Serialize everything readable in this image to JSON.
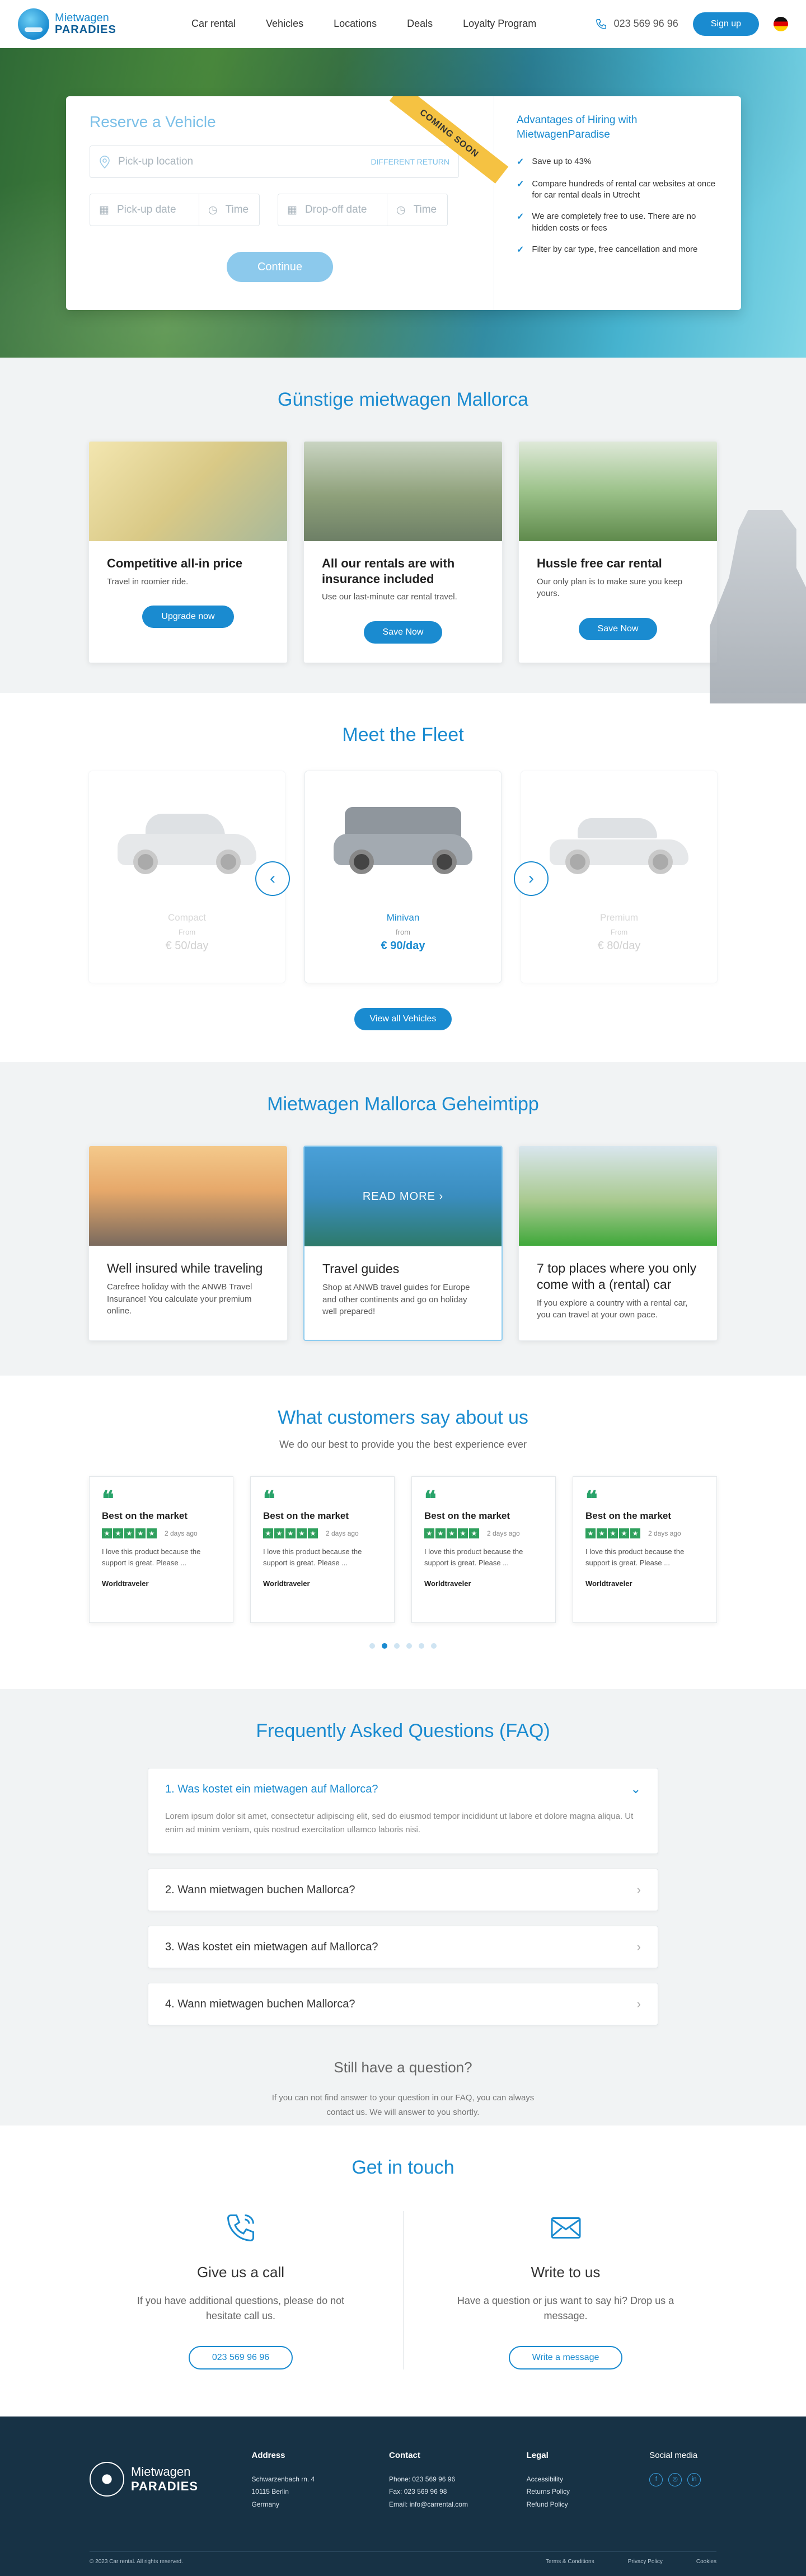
{
  "header": {
    "brand_top": "Mietwagen",
    "brand_bottom": "PARADIES",
    "nav": [
      "Car rental",
      "Vehicles",
      "Locations",
      "Deals",
      "Loyalty Program"
    ],
    "phone": "023 569 96 96",
    "signup": "Sign up"
  },
  "reserve": {
    "title": "Reserve a Vehicle",
    "ribbon": "COMING SOON",
    "pickup_placeholder": "Pick-up location",
    "different_return": "DIFFERENT RETURN",
    "pickup_date": "Pick-up date",
    "dropoff_date": "Drop-off date",
    "time": "Time",
    "continue": "Continue",
    "adv_title": "Advantages of Hiring with MietwagenParadise",
    "advantages": [
      "Save up to 43%",
      "Compare hundreds of rental car websites at once for car rental deals in Utrecht",
      "We are completely free to use. There are no hidden costs or fees",
      "Filter by car type, free cancellation and more"
    ]
  },
  "deals": {
    "title": "Günstige mietwagen Mallorca",
    "cards": [
      {
        "title": "Competitive all-in price",
        "text": "Travel in roomier ride.",
        "button": "Upgrade now"
      },
      {
        "title": "All our rentals are with insurance included",
        "text": "Use our last-minute car rental travel.",
        "button": "Save Now"
      },
      {
        "title": "Hussle free car rental",
        "text": "Our only plan is to make sure you keep yours.",
        "button": "Save Now"
      }
    ]
  },
  "fleet": {
    "title": "Meet the Fleet",
    "view_all": "View all Vehicles",
    "cars": [
      {
        "name": "Compact",
        "from": "From",
        "price": "€ 50/day"
      },
      {
        "name": "Minivan",
        "from": "from",
        "price": "€ 90/day"
      },
      {
        "name": "Premium",
        "from": "From",
        "price": "€ 80/day"
      }
    ]
  },
  "tips": {
    "title": "Mietwagen Mallorca Geheimtipp",
    "read_more": "READ MORE",
    "cards": [
      {
        "title": "Well insured while traveling",
        "text": "Carefree holiday with the ANWB Travel Insurance! You calculate your premium online."
      },
      {
        "title": "Travel guides",
        "text": "Shop at ANWB travel guides for Europe and other continents and go on holiday well prepared!"
      },
      {
        "title": "7 top places where you only come with a (rental) car",
        "text": "If you explore a country with a rental car, you can travel at your own pace."
      }
    ]
  },
  "reviews": {
    "title": "What customers say about us",
    "subtitle": "We do our best to provide you the best experience ever",
    "items": [
      {
        "title": "Best on the market",
        "ago": "2 days ago",
        "text": "I love this product because the support is great. Please ...",
        "author": "Worldtraveler"
      },
      {
        "title": "Best on the market",
        "ago": "2 days ago",
        "text": "I love this product because the support is great. Please ...",
        "author": "Worldtraveler"
      },
      {
        "title": "Best on the market",
        "ago": "2 days ago",
        "text": "I love this product because the support is great. Please ...",
        "author": "Worldtraveler"
      },
      {
        "title": "Best on the market",
        "ago": "2 days ago",
        "text": "I love this product because the support is great. Please ...",
        "author": "Worldtraveler"
      }
    ]
  },
  "faq": {
    "title": "Frequently Asked Questions (FAQ)",
    "items": [
      {
        "q": "1. Was kostet ein mietwagen auf Mallorca?",
        "a": "Lorem ipsum dolor sit amet, consectetur adipiscing elit, sed do eiusmod tempor incididunt ut labore et dolore magna aliqua. Ut enim ad minim veniam, quis nostrud exercitation ullamco laboris nisi."
      },
      {
        "q": "2. Wann mietwagen buchen Mallorca?"
      },
      {
        "q": "3. Was kostet ein mietwagen auf Mallorca?"
      },
      {
        "q": "4. Wann mietwagen buchen Mallorca?"
      }
    ],
    "still_title": "Still have a question?",
    "still_text": "If you can not find answer to your question in our FAQ, you can always contact us. We will answer to you shortly."
  },
  "contact": {
    "title": "Get in touch",
    "call_title": "Give us a call",
    "call_text": "If you have additional questions, please do not hesitate call us.",
    "call_button": "023 569 96 96",
    "write_title": "Write to us",
    "write_text": "Have a question or jus want to say hi? Drop us a message.",
    "write_button": "Write a message"
  },
  "footer": {
    "brand_top": "Mietwagen",
    "brand_bottom": "PARADIES",
    "address_title": "Address",
    "address": [
      "Schwarzenbach rn. 4",
      "10115 Berlin",
      "Germany"
    ],
    "contact_title": "Contact",
    "contact": [
      "Phone: 023 569 96 96",
      "Fax: 023 569 96 98",
      "Email: info@carrental.com"
    ],
    "legal_title": "Legal",
    "legal": [
      "Accessibility",
      "Returns Policy",
      "Refund Policy"
    ],
    "social_title": "Social media",
    "copyright": "© 2023 Car rental. All rights reserved.",
    "bottom_links": [
      "Terms & Conditions",
      "Privacy Policy",
      "Cookies"
    ]
  },
  "colors": {
    "primary": "#1a8bd0",
    "ribbon": "#f5c242",
    "footer": "#173245",
    "trust_green": "#2fa05d"
  }
}
